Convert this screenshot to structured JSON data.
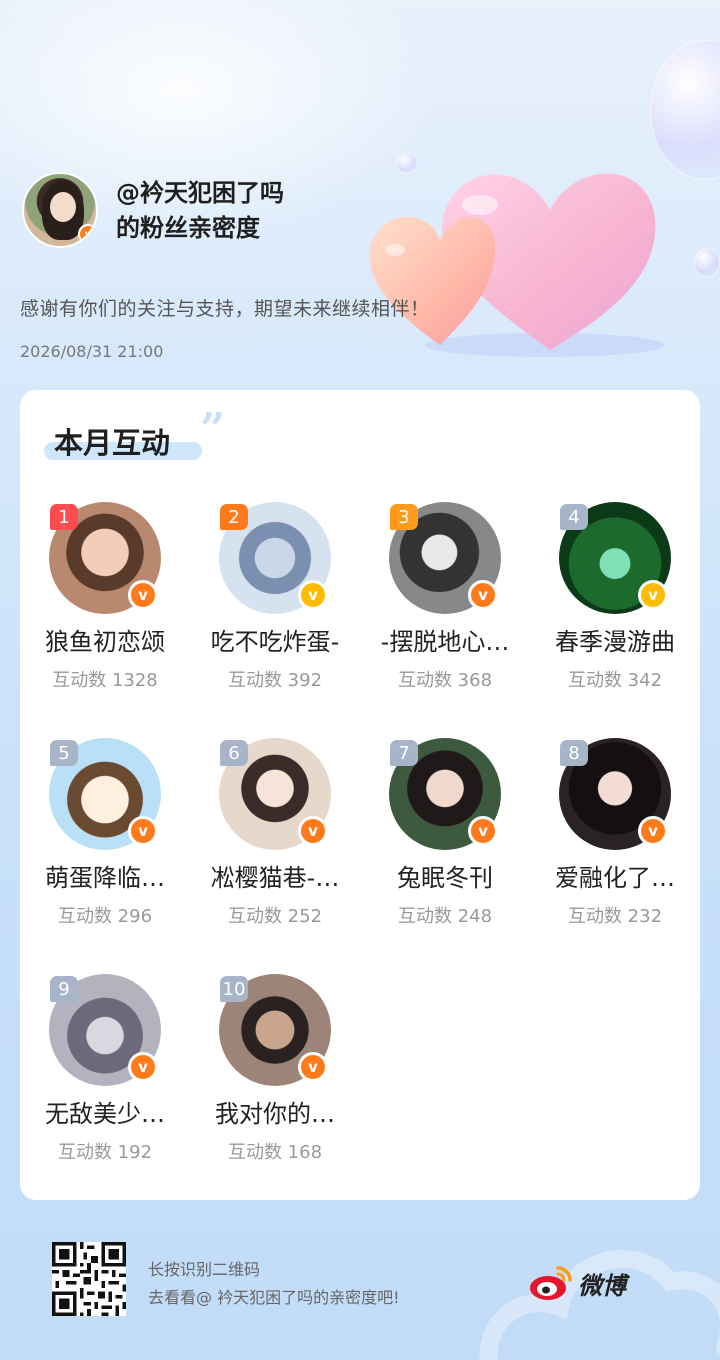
{
  "header": {
    "handle": "@衿天犯困了吗",
    "subtitle": "的粉丝亲密度",
    "tagline": "感谢有你们的关注与支持，期望未来继续相伴！",
    "datetime": "2026/08/31 21:00",
    "verified_badge": "v-badge-icon"
  },
  "card": {
    "title": "本月互动",
    "title_mark": "”",
    "fans": [
      {
        "rank": "1",
        "name": "狼鱼初恋颂",
        "count": "互动数 1328",
        "rank_color": "#ff4d4f",
        "badge": "orange"
      },
      {
        "rank": "2",
        "name": "吃不吃炸蛋-",
        "count": "互动数 392",
        "rank_color": "#ff7a1a",
        "badge": "gold"
      },
      {
        "rank": "3",
        "name": "-摆脱地心…",
        "count": "互动数 368",
        "rank_color": "#ff9a1a",
        "badge": "orange"
      },
      {
        "rank": "4",
        "name": "春季漫游曲",
        "count": "互动数 342",
        "rank_color": "#a8b4c8",
        "badge": "gold"
      },
      {
        "rank": "5",
        "name": "萌蛋降临…",
        "count": "互动数 296",
        "rank_color": "#a8b4c8",
        "badge": "orange"
      },
      {
        "rank": "6",
        "name": "凇樱猫巷-…",
        "count": "互动数 252",
        "rank_color": "#a8b4c8",
        "badge": "orange"
      },
      {
        "rank": "7",
        "name": "兔眠冬刊",
        "count": "互动数 248",
        "rank_color": "#a8b4c8",
        "badge": "orange"
      },
      {
        "rank": "8",
        "name": "爱融化了…",
        "count": "互动数 232",
        "rank_color": "#a8b4c8",
        "badge": "orange"
      },
      {
        "rank": "9",
        "name": "无敌美少…",
        "count": "互动数 192",
        "rank_color": "#a8b4c8",
        "badge": "orange"
      },
      {
        "rank": "10",
        "name": "我对你的…",
        "count": "互动数 168",
        "rank_color": "#a8b4c8",
        "badge": "orange"
      }
    ]
  },
  "footer": {
    "line1": "长按识别二维码",
    "line2": "去看看@ 衿天犯困了吗的亲密度吧!",
    "brand": "微博",
    "qr_icon": "qr-code-icon",
    "logo_icon": "weibo-logo-icon"
  },
  "colors": {
    "accent_orange": "#ff7a1a",
    "accent_gold": "#ffbb00",
    "card_bg": "#ffffff",
    "page_bg": "#d6e8fb"
  }
}
